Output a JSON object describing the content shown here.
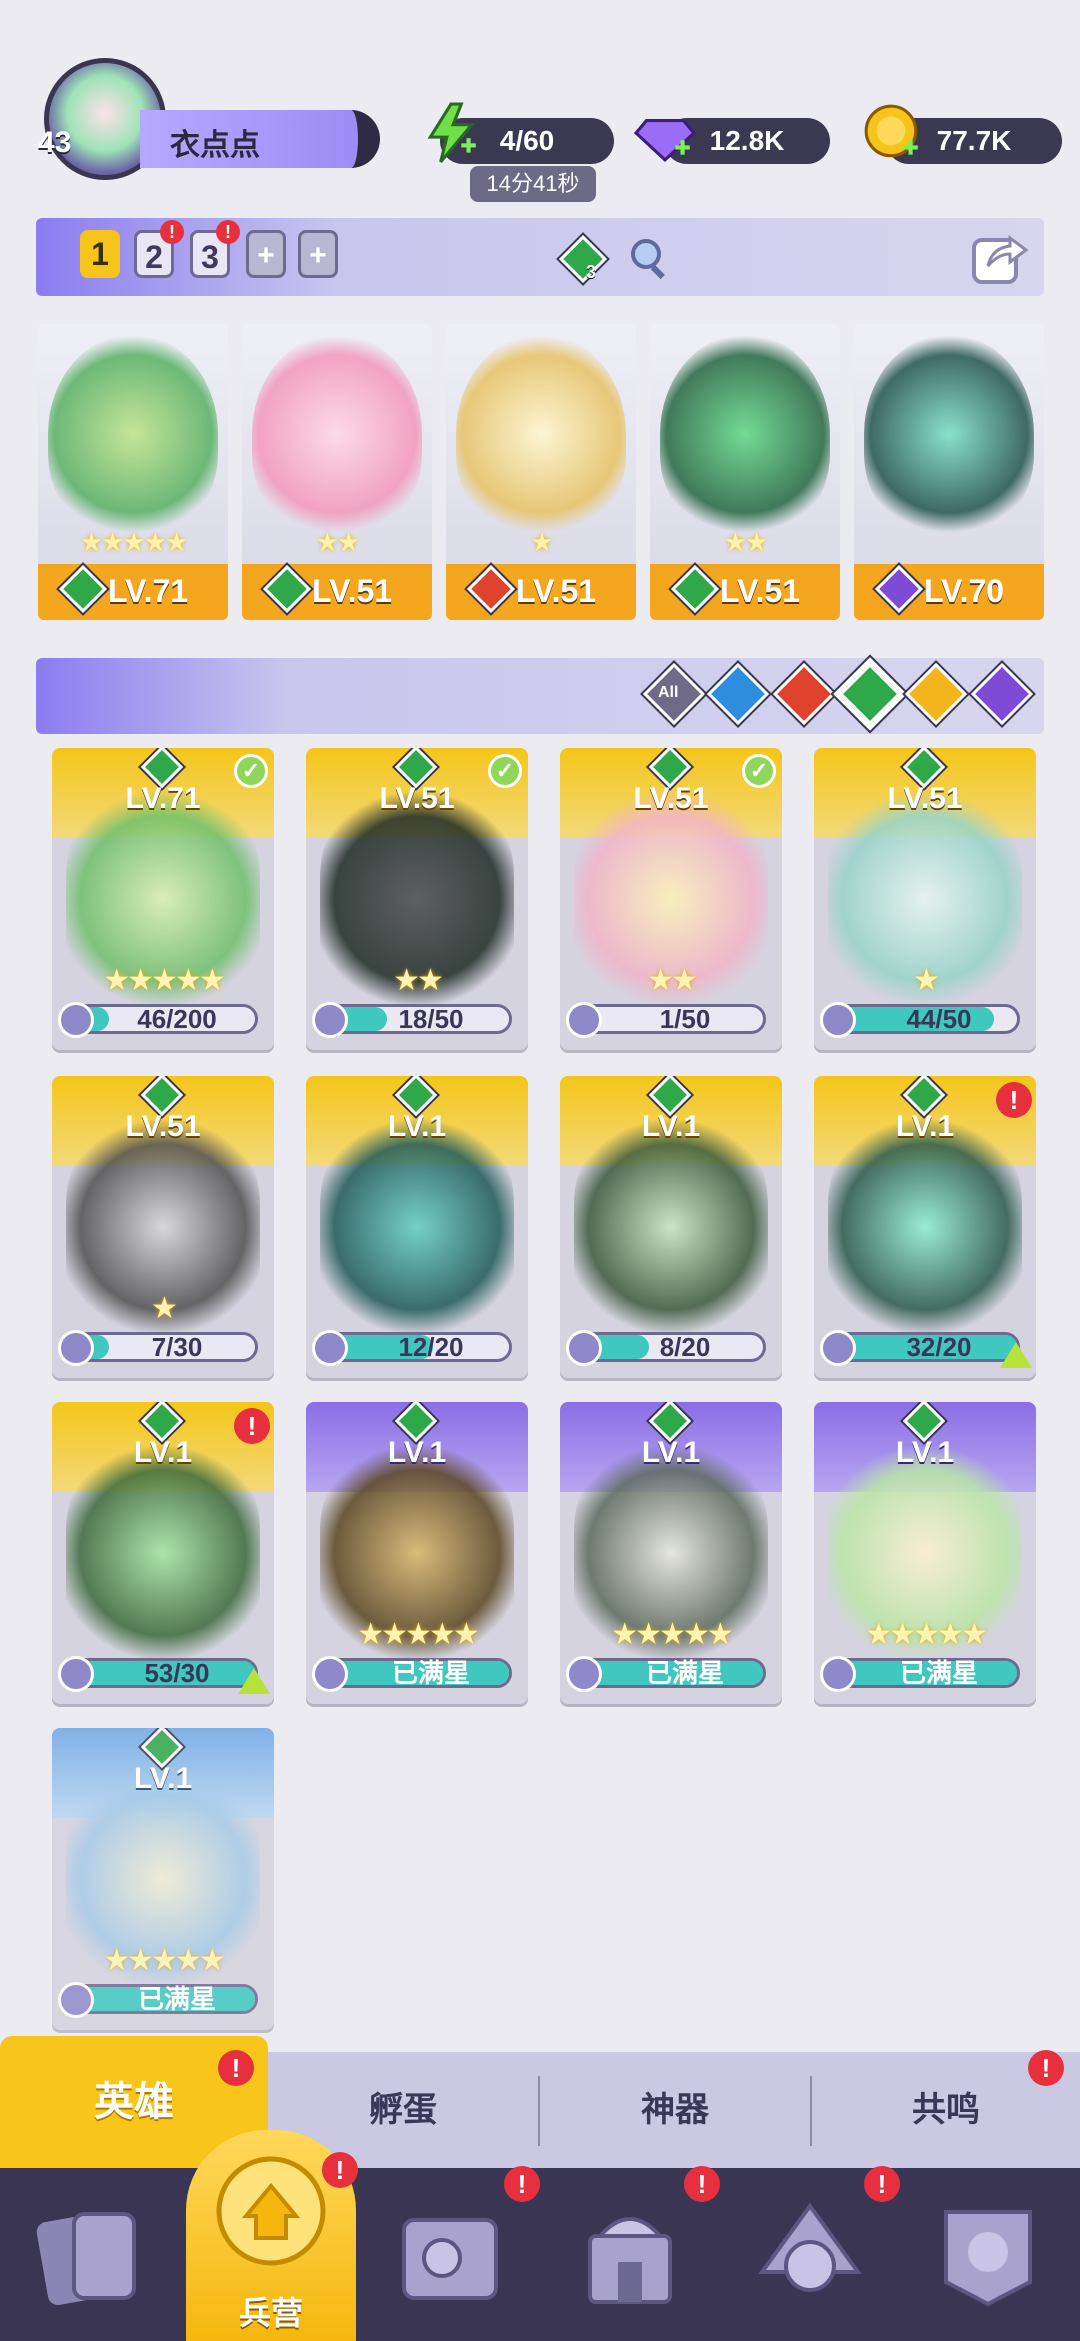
{
  "player": {
    "level": "43",
    "name": "衣点点"
  },
  "resources": {
    "energy": "4/60",
    "energy_timer": "14分41秒",
    "gems": "12.8K",
    "gold": "77.7K"
  },
  "team_tabs": [
    "1",
    "2",
    "3"
  ],
  "team_element_count": "3",
  "team_slots": [
    {
      "level": "LV.71",
      "stars": "★★★★★",
      "element": "green"
    },
    {
      "level": "LV.51",
      "stars": "★★",
      "element": "green"
    },
    {
      "level": "LV.51",
      "stars": "★",
      "element": "red"
    },
    {
      "level": "LV.51",
      "stars": "★★",
      "element": "green"
    },
    {
      "level": "LV.70",
      "stars": "",
      "element": "purple"
    }
  ],
  "filters": {
    "all_label": "All"
  },
  "heroes": [
    {
      "level": "LV.71",
      "progress": "46/200",
      "stars": "★★★★★",
      "rarity": "gold"
    },
    {
      "level": "LV.51",
      "progress": "18/50",
      "stars": "★★",
      "rarity": "gold"
    },
    {
      "level": "LV.51",
      "progress": "1/50",
      "stars": "★★",
      "rarity": "gold"
    },
    {
      "level": "LV.51",
      "progress": "44/50",
      "stars": "★",
      "rarity": "gold"
    },
    {
      "level": "LV.51",
      "progress": "7/30",
      "stars": "★",
      "rarity": "gold"
    },
    {
      "level": "LV.1",
      "progress": "12/20",
      "stars": "",
      "rarity": "gold"
    },
    {
      "level": "LV.1",
      "progress": "8/20",
      "stars": "",
      "rarity": "gold"
    },
    {
      "level": "LV.1",
      "progress": "32/20",
      "stars": "",
      "rarity": "gold"
    },
    {
      "level": "LV.1",
      "progress": "53/30",
      "stars": "",
      "rarity": "gold"
    },
    {
      "level": "LV.1",
      "progress": "已满星",
      "stars": "★★★★★",
      "rarity": "purple"
    },
    {
      "level": "LV.1",
      "progress": "已满星",
      "stars": "★★★★★",
      "rarity": "purple"
    },
    {
      "level": "LV.1",
      "progress": "已满星",
      "stars": "★★★★★",
      "rarity": "purple"
    },
    {
      "level": "LV.1",
      "progress": "已满星",
      "stars": "★★★★★",
      "rarity": "blue"
    }
  ],
  "tabs": [
    "英雄",
    "孵蛋",
    "神器",
    "共鸣"
  ],
  "nav": {
    "active_label": "兵营"
  },
  "alert_mark": "!",
  "colors": {
    "green": "#2fa84a",
    "red": "#e0432d",
    "purple": "#7e4bd6",
    "blue": "#2f8de0",
    "gold": "#f3b51c",
    "accent": "#8c7cf0"
  }
}
